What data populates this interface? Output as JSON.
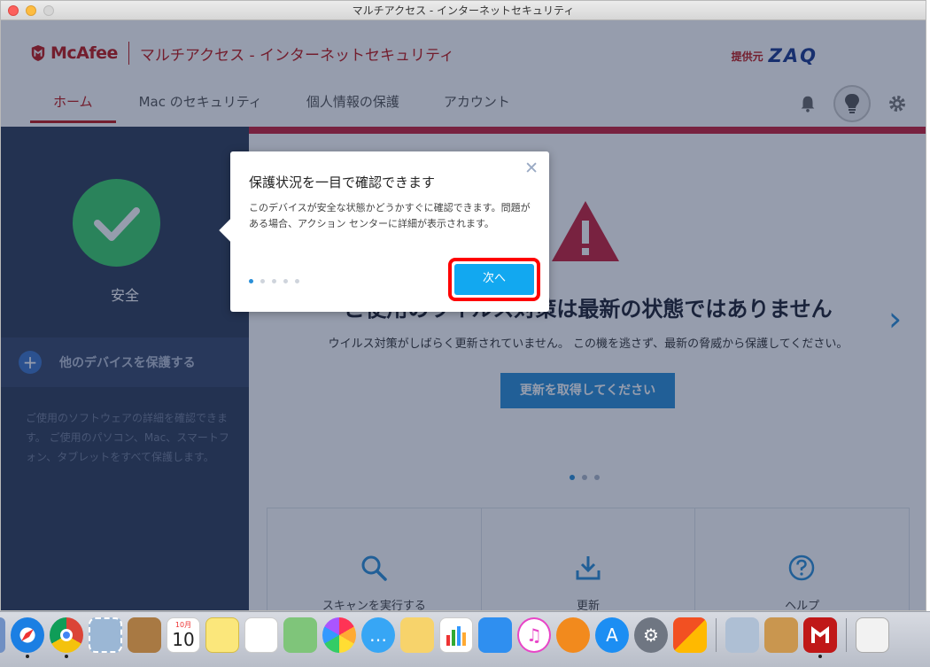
{
  "window": {
    "title": "マルチアクセス - インターネットセキュリティ"
  },
  "header": {
    "brand": "McAfee",
    "product": "マルチアクセス - インターネットセキュリティ",
    "provider_label": "提供元",
    "provider_name": "ZAQ",
    "tabs": [
      {
        "label": "ホーム",
        "active": true
      },
      {
        "label": "Mac のセキュリティ",
        "active": false
      },
      {
        "label": "個人情報の保護",
        "active": false
      },
      {
        "label": "アカウント",
        "active": false
      }
    ]
  },
  "sidebar": {
    "status_label": "安全",
    "protect_label": "他のデバイスを保護する",
    "description": "ご使用のソフトウェアの詳細を確認できます。 ご使用のパソコン、Mac、スマートフォン、タブレットをすべて保護します。"
  },
  "main": {
    "message_title": "ご使用のウイルス対策は最新の状態ではありません",
    "message_sub": "ウイルス対策がしばらく更新されていません。 この機を逃さず、最新の脅威から保護してください。",
    "update_button": "更新を取得してください",
    "cards": [
      {
        "label": "スキャンを実行する",
        "icon": "search-icon"
      },
      {
        "label": "更新",
        "icon": "download-icon"
      },
      {
        "label": "ヘルプ",
        "icon": "help-icon"
      }
    ]
  },
  "popup": {
    "title": "保護状況を一目で確認できます",
    "description": "このデバイスが安全な状態かどうかすぐに確認できます。問題がある場合、アクション センターに詳細が表示されます。",
    "next_button": "次へ",
    "step": 1,
    "total_steps": 5
  },
  "dock": {
    "calendar_month": "10月",
    "calendar_day": "10",
    "items": [
      "finder-icon",
      "safari-icon",
      "chrome-icon",
      "mail-stamp-icon",
      "contacts-icon",
      "calendar-icon",
      "notes-icon",
      "reminders-icon",
      "maps-icon",
      "photos-icon",
      "messages-icon",
      "stickies-icon",
      "numbers-icon",
      "keynote-icon",
      "itunes-icon",
      "books-icon",
      "app-store-icon",
      "system-preferences-icon",
      "office-icon",
      "preview-icon",
      "utility-icon",
      "mcafee-icon",
      "documents-icon"
    ]
  }
}
